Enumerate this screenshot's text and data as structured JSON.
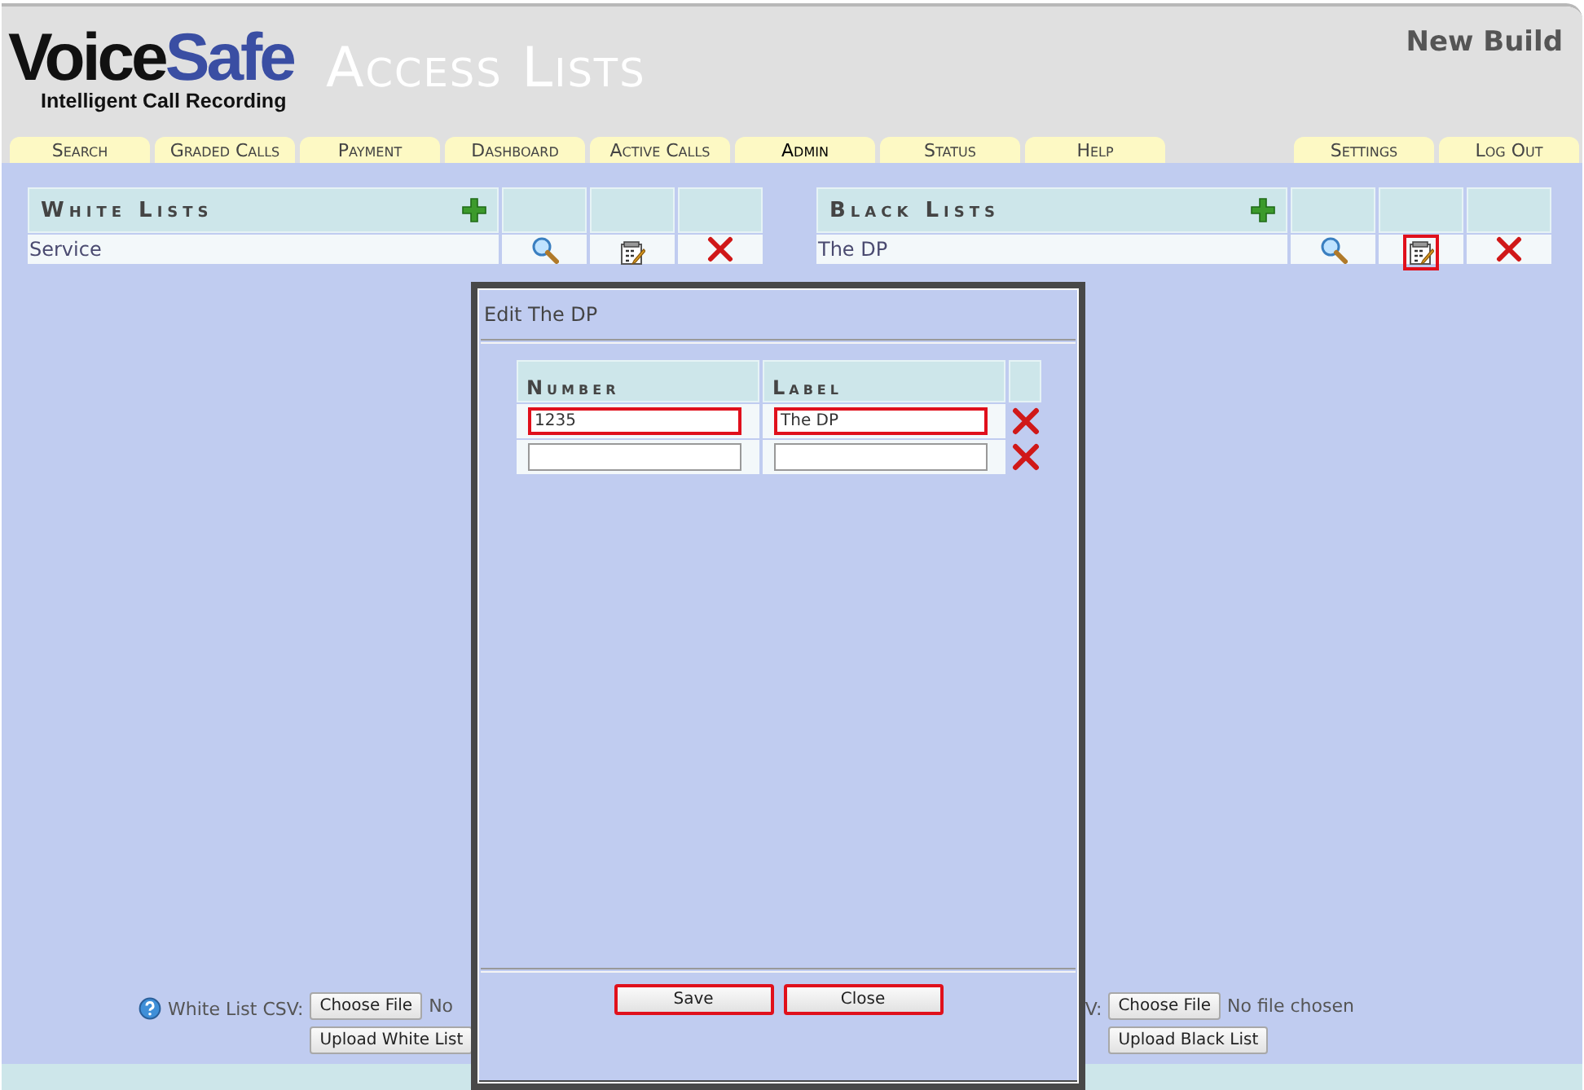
{
  "header": {
    "logo": {
      "part1": "Voice",
      "part2": "Safe",
      "tagline": "Intelligent Call Recording"
    },
    "page_title": "Access Lists",
    "build_label": "New Build"
  },
  "tabs": {
    "left": [
      {
        "label": "Search",
        "selected": false
      },
      {
        "label": "Graded Calls",
        "selected": false
      },
      {
        "label": "Payment",
        "selected": false
      },
      {
        "label": "Dashboard",
        "selected": false
      },
      {
        "label": "Active Calls",
        "selected": false
      },
      {
        "label": "Admin",
        "selected": true
      },
      {
        "label": "Status",
        "selected": false
      },
      {
        "label": "Help",
        "selected": false
      }
    ],
    "right": [
      {
        "label": "Settings",
        "selected": false
      },
      {
        "label": "Log Out",
        "selected": false
      }
    ]
  },
  "lists": [
    {
      "title": "White Lists",
      "rows": [
        {
          "name": "Service",
          "edit_highlighted": false
        }
      ]
    },
    {
      "title": "Black Lists",
      "rows": [
        {
          "name": "The DP",
          "edit_highlighted": true
        }
      ]
    }
  ],
  "uploads": [
    {
      "help_icon": true,
      "label": "White List CSV:",
      "choose": "Choose File",
      "status": "No",
      "upload": "Upload White List"
    },
    {
      "help_icon": false,
      "label": "V:",
      "choose": "Choose File",
      "status": "No file chosen",
      "upload": "Upload Black List"
    }
  ],
  "dialog": {
    "title": "Edit The DP",
    "columns": [
      "Number",
      "Label"
    ],
    "rows": [
      {
        "number": "1235",
        "label": "The DP",
        "highlighted": true
      },
      {
        "highlighted": false
      }
    ],
    "buttons": [
      {
        "label": "Save",
        "highlighted": true
      },
      {
        "label": "Close",
        "highlighted": true
      }
    ]
  }
}
